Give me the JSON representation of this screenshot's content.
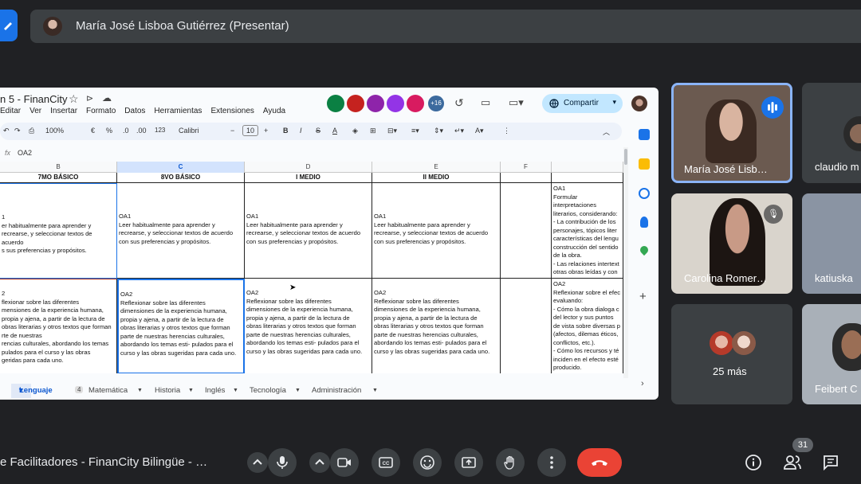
{
  "presenter_bar": {
    "name": "María José Lisboa Gutiérrez (Presentar)"
  },
  "doc": {
    "title": "n 5 - FinanCity",
    "menus": [
      "Editar",
      "Ver",
      "Insertar",
      "Formato",
      "Datos",
      "Herramientas",
      "Extensiones",
      "Ayuda"
    ],
    "collab_more": "+16",
    "share_label": "Compartir",
    "toolbar": {
      "zoom": "100%",
      "currency": "€",
      "percent": "%",
      "dec1": ".0",
      "dec2": ".00",
      "numfmt": "123",
      "font": "Calibri",
      "font_size": "10",
      "minus": "−",
      "plus": "+",
      "bold": "B",
      "italic": "I",
      "strike": "S",
      "textcolor": "A"
    },
    "fx_label": "fx",
    "cell_ref": "OA2",
    "columns": [
      "B",
      "C",
      "D",
      "E",
      "F",
      ""
    ],
    "headers": [
      "7MO BÁSICO",
      "8VO BÁSICO",
      "I MEDIO",
      "II MEDIO",
      "",
      ""
    ],
    "row1": {
      "b": "1\ner habitualmente para aprender y\nrecrearse, y seleccionar textos de acuerdo\ns sus preferencias y propósitos.",
      "c": "OA1\nLeer habitualmente para aprender y\nrecrearse, y seleccionar textos de acuerdo\ncon sus preferencias y propósitos.",
      "d": "OA1\nLeer habitualmente para aprender y\nrecrearse, y seleccionar textos de acuerdo\ncon sus preferencias y propósitos.",
      "e": "OA1\nLeer habitualmente para aprender y\nrecrearse, y seleccionar textos de acuerdo\ncon sus preferencias y propósitos.",
      "g": "OA1\nFormular interpretaciones\nliterarios, considerando:\n- La contribución de los\npersonajes, tópicos liter\ncaracterísticas del lengu\nconstrucción del sentido\nde la obra.\n- Las relaciones intertext\notras obras leídas y con\notros referentes de la cu"
    },
    "row2": {
      "b": "2\nflexionar sobre las diferentes\nmensiones de la experiencia humana,\npropia y ajena, a partir de la lectura de\nobras literarias y otros textos que forman\nrte de nuestras\nrencias culturales, abordando los temas\npulados para el curso y las obras\ngeridas para cada uno.",
      "c": "OA2\nReflexionar sobre las diferentes\ndimensiones de la experiencia humana,\npropia y ajena, a partir de la lectura de\nobras literarias y otros textos que forman\nparte de nuestras herencias culturales,\nabordando los temas esti- pulados para el\ncurso y las obras sugeridas para cada uno.",
      "d": "OA2\nReflexionar sobre las diferentes\ndimensiones de la experiencia humana,\npropia y ajena, a partir de la lectura de\nobras literarias y otros textos que forman\nparte de nuestras herencias culturales,\nabordando los temas esti- pulados para el\ncurso y las obras sugeridas para cada uno.",
      "e": "OA2\nReflexionar sobre las diferentes\ndimensiones de la experiencia humana,\npropia y ajena, a partir de la lectura de\nobras literarias y otros textos que forman\nparte de nuestras herencias culturales,\nabordando los temas esti- pulados para el\ncurso y las obras sugeridas para cada uno.",
      "g": "OA2\nReflexionar sobre el efec\nevaluando:\n- Cómo la obra dialoga c\ndel lector y sus puntos\nde vista sobre diversas p\n(afectos, dilemas éticos,\nconflictos, etc.).\n- Cómo los recursos y té\ninciden en el efecto esté\nproducido."
    },
    "sheet_tabs": {
      "active": "Lenguaje",
      "badge": "4",
      "tabs": [
        "Matemática",
        "Historia",
        "Inglés",
        "Tecnología",
        "Administración"
      ]
    }
  },
  "participants": [
    {
      "name": "María José Lisb…",
      "speaking": true
    },
    {
      "name": "claudio m"
    },
    {
      "name": "Carolina Romer…",
      "muted": true
    },
    {
      "name": "katiuska"
    },
    {
      "name": "25 más"
    },
    {
      "name": "Feibert C"
    }
  ],
  "bottom": {
    "meeting_title": "e Facilitadores - FinanCity Bilingüe - …",
    "participant_count": "31",
    "end_call_color": "#ea4335"
  },
  "colors": {
    "accent": "#1a73e8",
    "share_bg": "#c2e7ff",
    "selection": "#1a73e8"
  }
}
